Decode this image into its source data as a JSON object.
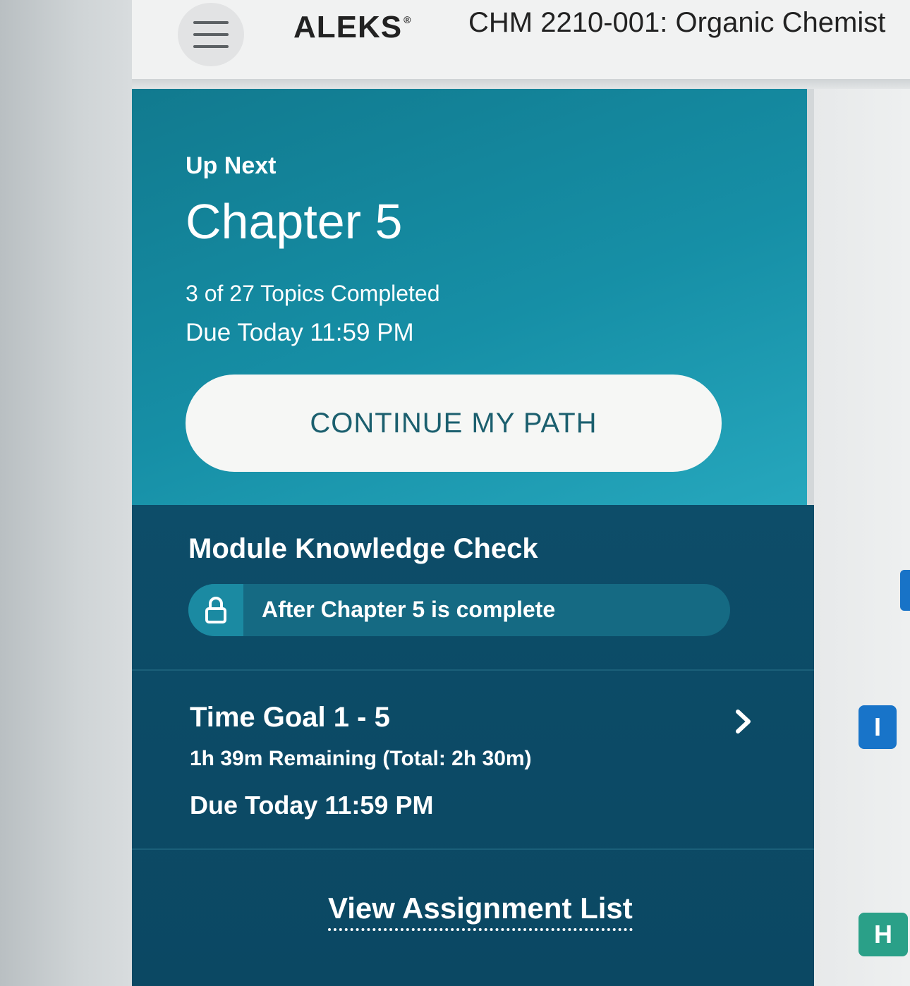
{
  "header": {
    "logo_text": "ALEKS",
    "logo_mark": "®",
    "course_title": "CHM 2210-001: Organic Chemist"
  },
  "up_next": {
    "label": "Up Next",
    "chapter": "Chapter 5",
    "topics_completed": "3 of 27 Topics Completed",
    "due": "Due Today 11:59 PM",
    "continue_label": "CONTINUE MY PATH"
  },
  "module_check": {
    "title": "Module Knowledge Check",
    "lock_text": "After Chapter 5 is complete"
  },
  "time_goal": {
    "title": "Time Goal 1 - 5",
    "remaining": "1h 39m Remaining (Total: 2h 30m)",
    "due": "Due Today 11:59 PM"
  },
  "footer": {
    "view_list": "View Assignment List"
  },
  "side_badges": {
    "badge_i": "I",
    "badge_h": "H"
  },
  "colors": {
    "teal_card": "#168fa6",
    "dark_panel": "#0d4d69",
    "badge_blue": "#1874c9",
    "badge_green": "#2aa088"
  }
}
